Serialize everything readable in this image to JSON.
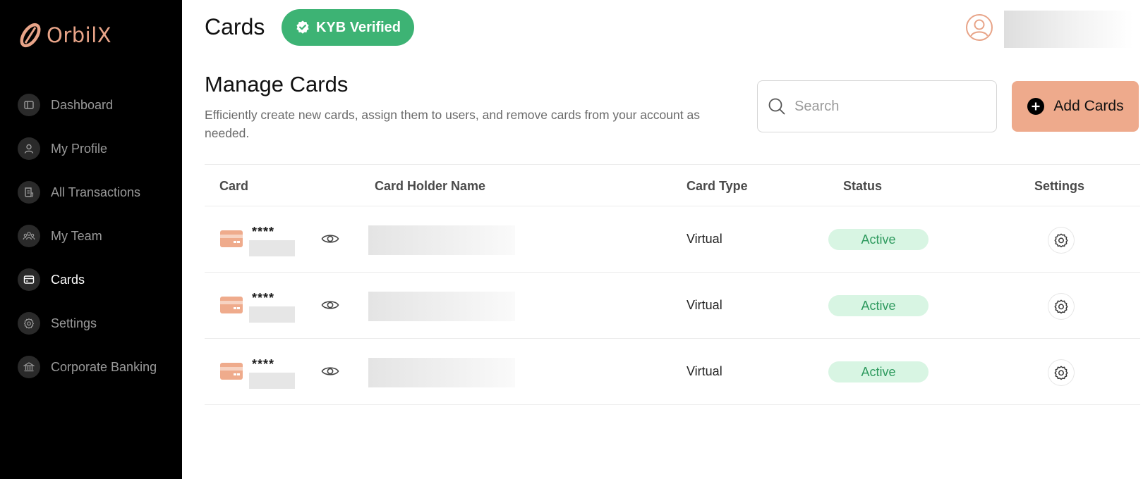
{
  "app": {
    "brand": "OrbilX"
  },
  "sidebar": {
    "items": [
      {
        "label": "Dashboard",
        "icon": "dashboard-icon"
      },
      {
        "label": "My Profile",
        "icon": "user-icon"
      },
      {
        "label": "All Transactions",
        "icon": "receipt-icon"
      },
      {
        "label": "My Team",
        "icon": "team-icon"
      },
      {
        "label": "Cards",
        "icon": "card-icon",
        "active": true
      },
      {
        "label": "Settings",
        "icon": "gear-icon"
      },
      {
        "label": "Corporate Banking",
        "icon": "bank-icon"
      }
    ]
  },
  "header": {
    "title": "Cards",
    "badge": "KYB Verified"
  },
  "section": {
    "title": "Manage Cards",
    "description": "Efficiently create new cards, assign them to users, and remove cards from your account as needed."
  },
  "search": {
    "placeholder": "Search"
  },
  "actions": {
    "add_label": "Add Cards"
  },
  "table": {
    "columns": [
      "Card",
      "Card Holder Name",
      "Card Type",
      "Status",
      "Settings"
    ],
    "rows": [
      {
        "card_mask": "****",
        "card_type": "Virtual",
        "status": "Active"
      },
      {
        "card_mask": "****",
        "card_type": "Virtual",
        "status": "Active"
      },
      {
        "card_mask": "****",
        "card_type": "Virtual",
        "status": "Active"
      }
    ]
  },
  "colors": {
    "sidebar_bg": "#000000",
    "accent": "#eeaa8c",
    "brand": "#e8a488",
    "kyb_badge": "#3db374",
    "status_bg": "#d8f5e3",
    "status_text": "#2e9a5e"
  }
}
